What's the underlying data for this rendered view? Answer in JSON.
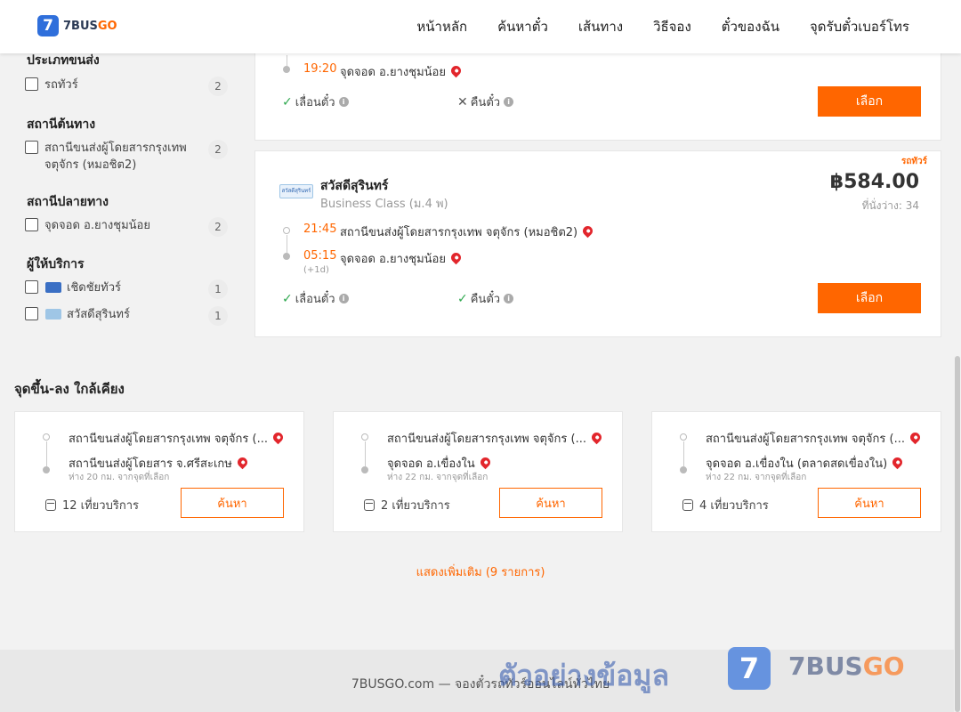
{
  "header": {
    "logo_number": "7",
    "logo_brand": "7BUS",
    "logo_go": "GO",
    "nav": [
      "หน้าหลัก",
      "ค้นหาตั๋ว",
      "เส้นทาง",
      "วิธีจอง",
      "ตั๋วของฉัน",
      "จุดรับตั๋วเบอร์โทร"
    ]
  },
  "sidebar": {
    "transport_type": {
      "title": "ประเภทขนส่ง",
      "items": [
        {
          "label": "รถทัวร์",
          "count": "2"
        }
      ]
    },
    "origin": {
      "title": "สถานีต้นทาง",
      "items": [
        {
          "label": "สถานีขนส่งผู้โดยสารกรุงเทพ จตุจักร (หมอชิต2)",
          "count": "2"
        }
      ]
    },
    "destination": {
      "title": "สถานีปลายทาง",
      "items": [
        {
          "label": "จุดจอด อ.ยางชุมน้อย",
          "count": "2"
        }
      ]
    },
    "operators": {
      "title": "ผู้ให้บริการ",
      "items": [
        {
          "label": "เชิดชัยทัวร์",
          "count": "1",
          "color": "#3a6fc4"
        },
        {
          "label": "สวัสดีสุรินทร์",
          "count": "1",
          "color": "#9fc6e6"
        }
      ]
    }
  },
  "trip1": {
    "arrive_time": "19:20",
    "arrive_stop": "จุดจอด อ.ยางชุมน้อย",
    "reschedule": "เลื่อนตั๋ว",
    "refund": "คืนตั๋ว",
    "select_label": "เลือก"
  },
  "trip2": {
    "bus_type": "รถทัวร์",
    "operator": "สวัสดีสุรินทร์",
    "operator_logo_text": "สวัสดีสุรินทร์",
    "bus_class": "Business Class (ม.4 พ)",
    "price": "฿584.00",
    "seats": "ที่นั่งว่าง: 34",
    "depart_time": "21:45",
    "depart_stop": "สถานีขนส่งผู้โดยสารกรุงเทพ จตุจักร (หมอชิต2)",
    "arrive_time": "05:15",
    "arrive_stop": "จุดจอด อ.ยางชุมน้อย",
    "next_day": "(+1d)",
    "reschedule": "เลื่อนตั๋ว",
    "refund": "คืนตั๋ว",
    "select_label": "เลือก"
  },
  "nearby": {
    "title": "จุดขึ้น-ลง ใกล้เคียง",
    "cards": [
      {
        "from": "สถานีขนส่งผู้โดยสารกรุงเทพ จตุจักร (...",
        "to": "สถานีขนส่งผู้โดยสาร จ.ศรีสะเกษ",
        "distance": "ห่าง 20 กม. จากจุดที่เลือก",
        "trips": "12 เที่ยวบริการ",
        "search": "ค้นหา"
      },
      {
        "from": "สถานีขนส่งผู้โดยสารกรุงเทพ จตุจักร (...",
        "to": "จุดจอด อ.เขื่องใน",
        "distance": "ห่าง 22 กม. จากจุดที่เลือก",
        "trips": "2 เที่ยวบริการ",
        "search": "ค้นหา"
      },
      {
        "from": "สถานีขนส่งผู้โดยสารกรุงเทพ จตุจักร (...",
        "to": "จุดจอด อ.เขื่องใน (ตลาดสดเขื่องใน)",
        "distance": "ห่าง 22 กม. จากจุดที่เลือก",
        "trips": "4 เที่ยวบริการ",
        "search": "ค้นหา"
      }
    ],
    "show_more": "แสดงเพิ่มเติม (9 รายการ)"
  },
  "footer": {
    "text": "7BUSGO.com — จองตั๋วรถทัวร์ออนไลน์ทั่วไทย",
    "watermark": "ตัวอย่างข้อมูล",
    "wm_number": "7",
    "wm_brand": "7BUS",
    "wm_go": "GO"
  }
}
